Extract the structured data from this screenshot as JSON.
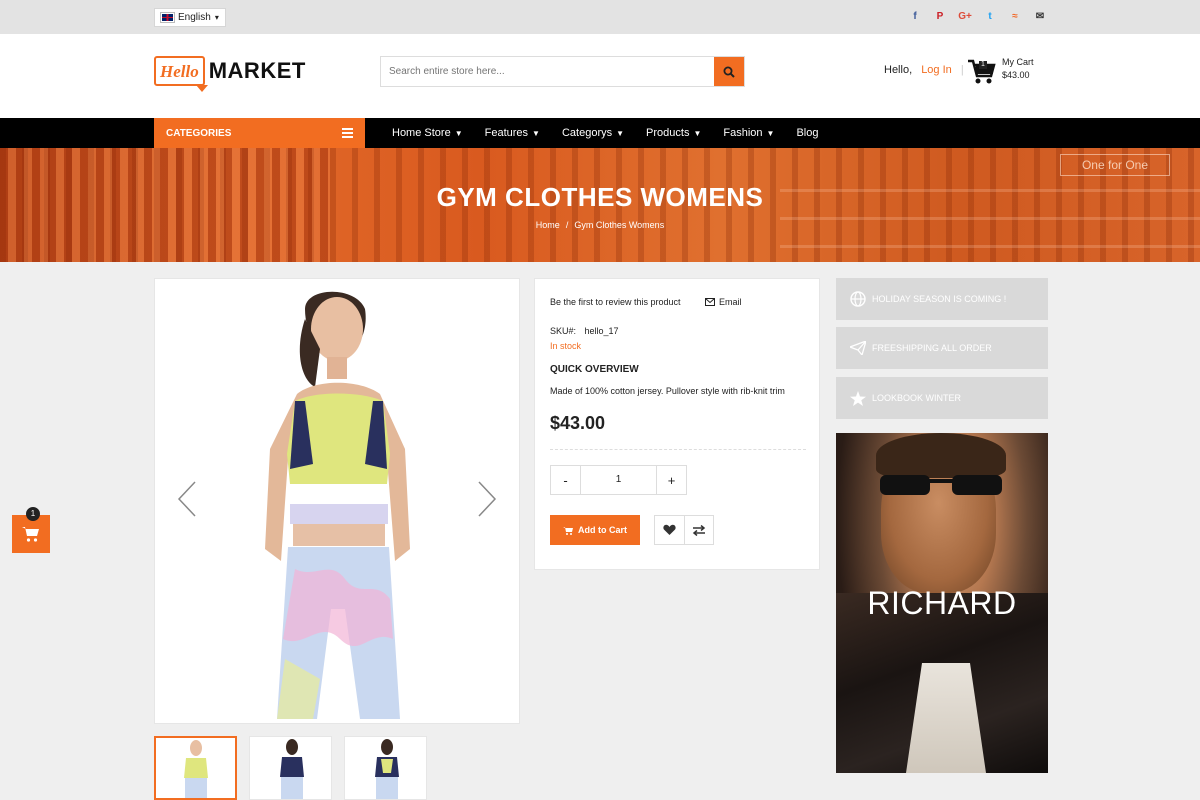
{
  "topbar": {
    "language": "English",
    "socials": [
      {
        "icon": "facebook-icon",
        "glyph": "f",
        "color": "#3b5998"
      },
      {
        "icon": "pinterest-icon",
        "glyph": "P",
        "color": "#cb2027"
      },
      {
        "icon": "google-plus-icon",
        "glyph": "G+",
        "color": "#dd4b39"
      },
      {
        "icon": "twitter-icon",
        "glyph": "t",
        "color": "#1da1f2"
      },
      {
        "icon": "rss-icon",
        "glyph": "≈",
        "color": "#f26522"
      },
      {
        "icon": "email-icon",
        "glyph": "✉",
        "color": "#333333"
      }
    ]
  },
  "header": {
    "logo_script": "Hello",
    "logo_text": "MARKET",
    "search_placeholder": "Search entire store here...",
    "hello_label": "Hello,",
    "login_label": "Log In",
    "login_sep": "|",
    "cart_label": "My Cart",
    "cart_total": "$43.00",
    "cart_count": "1"
  },
  "nav": {
    "categories_label": "CATEGORIES",
    "items": [
      {
        "label": "Home Store",
        "dropdown": true
      },
      {
        "label": "Features",
        "dropdown": true
      },
      {
        "label": "Categorys",
        "dropdown": true
      },
      {
        "label": "Products",
        "dropdown": true
      },
      {
        "label": "Fashion",
        "dropdown": true
      },
      {
        "label": "Blog",
        "dropdown": false
      }
    ]
  },
  "banner": {
    "title": "GYM CLOTHES WOMENS",
    "sign": "One for One",
    "breadcrumb": [
      "Home",
      "Gym Clothes Womens"
    ]
  },
  "product": {
    "review_text": "Be the first to review this product",
    "email_label": "Email",
    "sku_label": "SKU#:",
    "sku_value": "hello_17",
    "stock": "In stock",
    "overview_title": "QUICK OVERVIEW",
    "overview_text": "Made of 100% cotton jersey. Pullover style with rib-knit trim",
    "price": "$43.00",
    "qty_minus": "-",
    "qty_value": "1",
    "qty_plus": "+",
    "add_to_cart": "Add to Cart"
  },
  "sidebar": {
    "promos": [
      {
        "icon": "globe-icon",
        "label": "HOLIDAY SEASON IS COMING !"
      },
      {
        "icon": "paper-plane-icon",
        "label": "FREESHIPPING ALL ORDER"
      },
      {
        "icon": "star-icon",
        "label": "LOOKBOOK WINTER"
      }
    ],
    "ad_title": "RICHARD"
  },
  "floating_cart": {
    "count": "1"
  },
  "colors": {
    "accent": "#f26d21",
    "nav_bg": "#000000",
    "promo_bg": "#d9d9d9"
  }
}
